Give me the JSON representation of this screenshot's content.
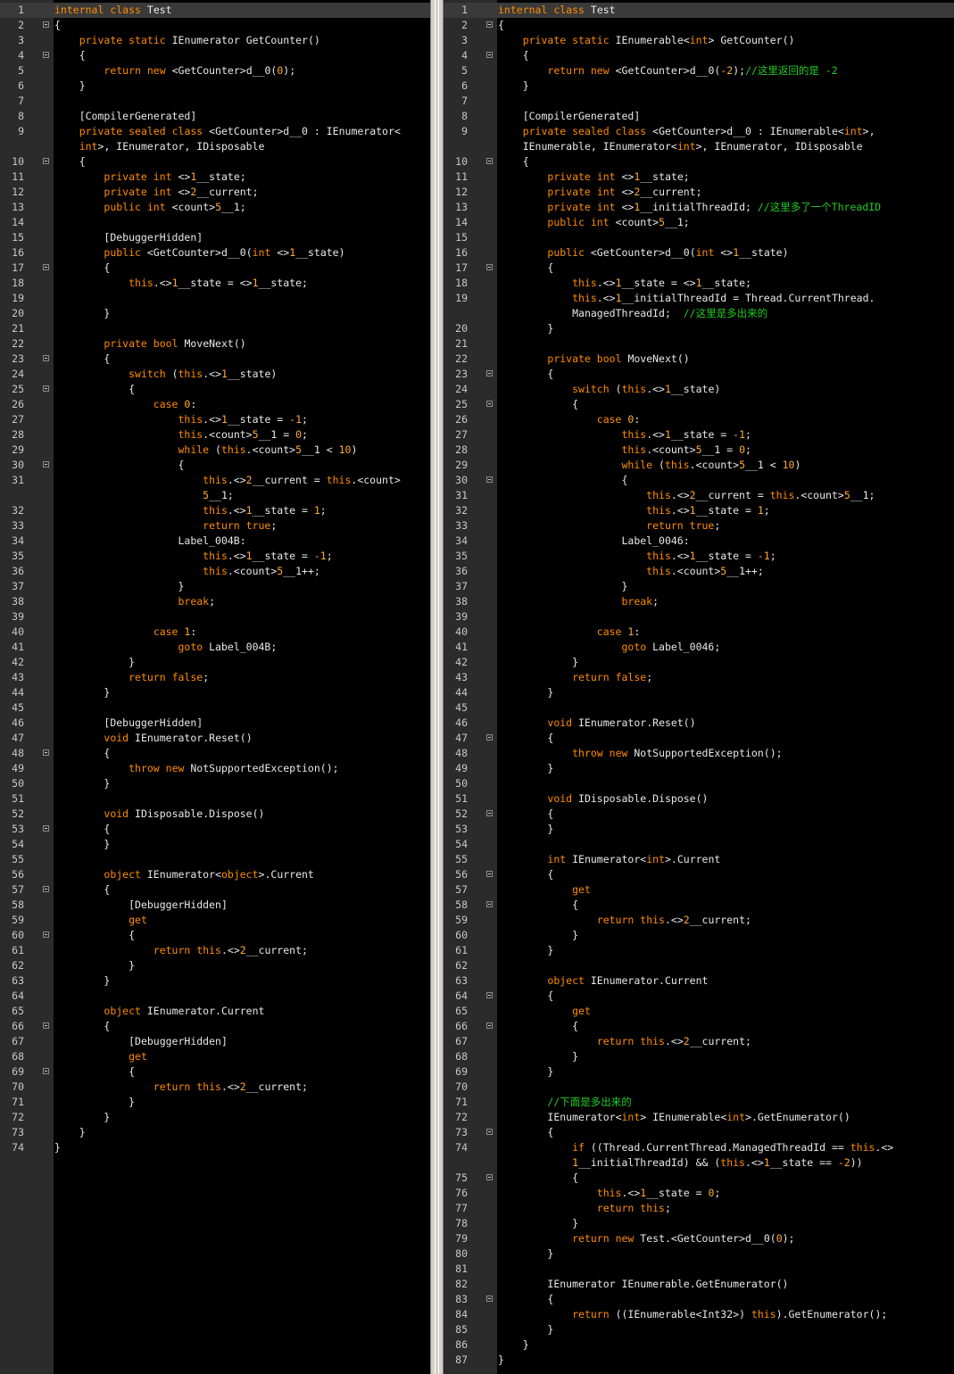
{
  "colors": {
    "keyword": "#ff8c00",
    "comment": "#22cc22",
    "plain": "#e8e8e8",
    "background": "#000000",
    "gutter": "#2b2b2b"
  },
  "left": {
    "lines": [
      {
        "n": "1",
        "t": "internal class Test",
        "hl": true
      },
      {
        "n": "2",
        "t": "{",
        "f": true
      },
      {
        "n": "3",
        "t": "    private static IEnumerator GetCounter()"
      },
      {
        "n": "4",
        "t": "    {",
        "f": true
      },
      {
        "n": "5",
        "t": "        return new <GetCounter>d__0(0);"
      },
      {
        "n": "6",
        "t": "    }"
      },
      {
        "n": "7",
        "t": ""
      },
      {
        "n": "8",
        "t": "    [CompilerGenerated]"
      },
      {
        "n": "9",
        "t": "    private sealed class <GetCounter>d__0 : IEnumerator<"
      },
      {
        "n": "",
        "t": "    int>, IEnumerator, IDisposable"
      },
      {
        "n": "10",
        "t": "    {",
        "f": true
      },
      {
        "n": "11",
        "t": "        private int <>1__state;"
      },
      {
        "n": "12",
        "t": "        private int <>2__current;"
      },
      {
        "n": "13",
        "t": "        public int <count>5__1;"
      },
      {
        "n": "14",
        "t": ""
      },
      {
        "n": "15",
        "t": "        [DebuggerHidden]"
      },
      {
        "n": "16",
        "t": "        public <GetCounter>d__0(int <>1__state)"
      },
      {
        "n": "17",
        "t": "        {",
        "f": true
      },
      {
        "n": "18",
        "t": "            this.<>1__state = <>1__state;"
      },
      {
        "n": "19",
        "t": ""
      },
      {
        "n": "20",
        "t": "        }"
      },
      {
        "n": "21",
        "t": ""
      },
      {
        "n": "22",
        "t": "        private bool MoveNext()"
      },
      {
        "n": "23",
        "t": "        {",
        "f": true
      },
      {
        "n": "24",
        "t": "            switch (this.<>1__state)"
      },
      {
        "n": "25",
        "t": "            {",
        "f": true
      },
      {
        "n": "26",
        "t": "                case 0:"
      },
      {
        "n": "27",
        "t": "                    this.<>1__state = -1;"
      },
      {
        "n": "28",
        "t": "                    this.<count>5__1 = 0;"
      },
      {
        "n": "29",
        "t": "                    while (this.<count>5__1 < 10)"
      },
      {
        "n": "30",
        "t": "                    {",
        "f": true
      },
      {
        "n": "31",
        "t": "                        this.<>2__current = this.<count>"
      },
      {
        "n": "",
        "t": "                        5__1;"
      },
      {
        "n": "32",
        "t": "                        this.<>1__state = 1;"
      },
      {
        "n": "33",
        "t": "                        return true;"
      },
      {
        "n": "34",
        "t": "                    Label_004B:"
      },
      {
        "n": "35",
        "t": "                        this.<>1__state = -1;"
      },
      {
        "n": "36",
        "t": "                        this.<count>5__1++;"
      },
      {
        "n": "37",
        "t": "                    }"
      },
      {
        "n": "38",
        "t": "                    break;"
      },
      {
        "n": "39",
        "t": ""
      },
      {
        "n": "40",
        "t": "                case 1:"
      },
      {
        "n": "41",
        "t": "                    goto Label_004B;"
      },
      {
        "n": "42",
        "t": "            }"
      },
      {
        "n": "43",
        "t": "            return false;"
      },
      {
        "n": "44",
        "t": "        }"
      },
      {
        "n": "45",
        "t": ""
      },
      {
        "n": "46",
        "t": "        [DebuggerHidden]"
      },
      {
        "n": "47",
        "t": "        void IEnumerator.Reset()"
      },
      {
        "n": "48",
        "t": "        {",
        "f": true
      },
      {
        "n": "49",
        "t": "            throw new NotSupportedException();"
      },
      {
        "n": "50",
        "t": "        }"
      },
      {
        "n": "51",
        "t": ""
      },
      {
        "n": "52",
        "t": "        void IDisposable.Dispose()"
      },
      {
        "n": "53",
        "t": "        {",
        "f": true
      },
      {
        "n": "54",
        "t": "        }"
      },
      {
        "n": "55",
        "t": ""
      },
      {
        "n": "56",
        "t": "        object IEnumerator<object>.Current"
      },
      {
        "n": "57",
        "t": "        {",
        "f": true
      },
      {
        "n": "58",
        "t": "            [DebuggerHidden]"
      },
      {
        "n": "59",
        "t": "            get"
      },
      {
        "n": "60",
        "t": "            {",
        "f": true
      },
      {
        "n": "61",
        "t": "                return this.<>2__current;"
      },
      {
        "n": "62",
        "t": "            }"
      },
      {
        "n": "63",
        "t": "        }"
      },
      {
        "n": "64",
        "t": ""
      },
      {
        "n": "65",
        "t": "        object IEnumerator.Current"
      },
      {
        "n": "66",
        "t": "        {",
        "f": true
      },
      {
        "n": "67",
        "t": "            [DebuggerHidden]"
      },
      {
        "n": "68",
        "t": "            get"
      },
      {
        "n": "69",
        "t": "            {",
        "f": true
      },
      {
        "n": "70",
        "t": "                return this.<>2__current;"
      },
      {
        "n": "71",
        "t": "            }"
      },
      {
        "n": "72",
        "t": "        }"
      },
      {
        "n": "73",
        "t": "    }"
      },
      {
        "n": "74",
        "t": "}"
      }
    ]
  },
  "right": {
    "lines": [
      {
        "n": "1",
        "t": "internal class Test",
        "hl": true
      },
      {
        "n": "2",
        "t": "{",
        "f": true
      },
      {
        "n": "3",
        "t": "    private static IEnumerable<int> GetCounter()"
      },
      {
        "n": "4",
        "t": "    {",
        "f": true
      },
      {
        "n": "5",
        "t": "        return new <GetCounter>d__0(-2);//这里返回的是 -2"
      },
      {
        "n": "6",
        "t": "    }"
      },
      {
        "n": "7",
        "t": ""
      },
      {
        "n": "8",
        "t": "    [CompilerGenerated]"
      },
      {
        "n": "9",
        "t": "    private sealed class <GetCounter>d__0 : IEnumerable<int>,"
      },
      {
        "n": "",
        "t": "    IEnumerable, IEnumerator<int>, IEnumerator, IDisposable"
      },
      {
        "n": "10",
        "t": "    {",
        "f": true
      },
      {
        "n": "11",
        "t": "        private int <>1__state;"
      },
      {
        "n": "12",
        "t": "        private int <>2__current;"
      },
      {
        "n": "13",
        "t": "        private int <>1__initialThreadId; //这里多了一个ThreadID"
      },
      {
        "n": "14",
        "t": "        public int <count>5__1;"
      },
      {
        "n": "15",
        "t": ""
      },
      {
        "n": "16",
        "t": "        public <GetCounter>d__0(int <>1__state)"
      },
      {
        "n": "17",
        "t": "        {",
        "f": true
      },
      {
        "n": "18",
        "t": "            this.<>1__state = <>1__state;"
      },
      {
        "n": "19",
        "t": "            this.<>1__initialThreadId = Thread.CurrentThread."
      },
      {
        "n": "",
        "t": "            ManagedThreadId;  //这里是多出来的"
      },
      {
        "n": "20",
        "t": "        }"
      },
      {
        "n": "21",
        "t": ""
      },
      {
        "n": "22",
        "t": "        private bool MoveNext()"
      },
      {
        "n": "23",
        "t": "        {",
        "f": true
      },
      {
        "n": "24",
        "t": "            switch (this.<>1__state)"
      },
      {
        "n": "25",
        "t": "            {",
        "f": true
      },
      {
        "n": "26",
        "t": "                case 0:"
      },
      {
        "n": "27",
        "t": "                    this.<>1__state = -1;"
      },
      {
        "n": "28",
        "t": "                    this.<count>5__1 = 0;"
      },
      {
        "n": "29",
        "t": "                    while (this.<count>5__1 < 10)"
      },
      {
        "n": "30",
        "t": "                    {",
        "f": true
      },
      {
        "n": "31",
        "t": "                        this.<>2__current = this.<count>5__1;"
      },
      {
        "n": "32",
        "t": "                        this.<>1__state = 1;"
      },
      {
        "n": "33",
        "t": "                        return true;"
      },
      {
        "n": "34",
        "t": "                    Label_0046:"
      },
      {
        "n": "35",
        "t": "                        this.<>1__state = -1;"
      },
      {
        "n": "36",
        "t": "                        this.<count>5__1++;"
      },
      {
        "n": "37",
        "t": "                    }"
      },
      {
        "n": "38",
        "t": "                    break;"
      },
      {
        "n": "39",
        "t": ""
      },
      {
        "n": "40",
        "t": "                case 1:"
      },
      {
        "n": "41",
        "t": "                    goto Label_0046;"
      },
      {
        "n": "42",
        "t": "            }"
      },
      {
        "n": "43",
        "t": "            return false;"
      },
      {
        "n": "44",
        "t": "        }"
      },
      {
        "n": "45",
        "t": ""
      },
      {
        "n": "46",
        "t": "        void IEnumerator.Reset()"
      },
      {
        "n": "47",
        "t": "        {",
        "f": true
      },
      {
        "n": "48",
        "t": "            throw new NotSupportedException();"
      },
      {
        "n": "49",
        "t": "        }"
      },
      {
        "n": "50",
        "t": ""
      },
      {
        "n": "51",
        "t": "        void IDisposable.Dispose()"
      },
      {
        "n": "52",
        "t": "        {",
        "f": true
      },
      {
        "n": "53",
        "t": "        }"
      },
      {
        "n": "54",
        "t": ""
      },
      {
        "n": "55",
        "t": "        int IEnumerator<int>.Current"
      },
      {
        "n": "56",
        "t": "        {",
        "f": true
      },
      {
        "n": "57",
        "t": "            get"
      },
      {
        "n": "58",
        "t": "            {",
        "f": true
      },
      {
        "n": "59",
        "t": "                return this.<>2__current;"
      },
      {
        "n": "60",
        "t": "            }"
      },
      {
        "n": "61",
        "t": "        }"
      },
      {
        "n": "62",
        "t": ""
      },
      {
        "n": "63",
        "t": "        object IEnumerator.Current"
      },
      {
        "n": "64",
        "t": "        {",
        "f": true
      },
      {
        "n": "65",
        "t": "            get"
      },
      {
        "n": "66",
        "t": "            {",
        "f": true
      },
      {
        "n": "67",
        "t": "                return this.<>2__current;"
      },
      {
        "n": "68",
        "t": "            }"
      },
      {
        "n": "69",
        "t": "        }"
      },
      {
        "n": "70",
        "t": ""
      },
      {
        "n": "71",
        "t": "        //下面是多出来的"
      },
      {
        "n": "72",
        "t": "        IEnumerator<int> IEnumerable<int>.GetEnumerator()"
      },
      {
        "n": "73",
        "t": "        {",
        "f": true
      },
      {
        "n": "74",
        "t": "            if ((Thread.CurrentThread.ManagedThreadId == this.<>"
      },
      {
        "n": "",
        "t": "            1__initialThreadId) && (this.<>1__state == -2))"
      },
      {
        "n": "75",
        "t": "            {",
        "f": true
      },
      {
        "n": "76",
        "t": "                this.<>1__state = 0;"
      },
      {
        "n": "77",
        "t": "                return this;"
      },
      {
        "n": "78",
        "t": "            }"
      },
      {
        "n": "79",
        "t": "            return new Test.<GetCounter>d__0(0);"
      },
      {
        "n": "80",
        "t": "        }"
      },
      {
        "n": "81",
        "t": ""
      },
      {
        "n": "82",
        "t": "        IEnumerator IEnumerable.GetEnumerator()"
      },
      {
        "n": "83",
        "t": "        {",
        "f": true
      },
      {
        "n": "84",
        "t": "            return ((IEnumerable<Int32>) this).GetEnumerator();"
      },
      {
        "n": "85",
        "t": "        }"
      },
      {
        "n": "86",
        "t": "    }"
      },
      {
        "n": "87",
        "t": "}"
      }
    ]
  }
}
